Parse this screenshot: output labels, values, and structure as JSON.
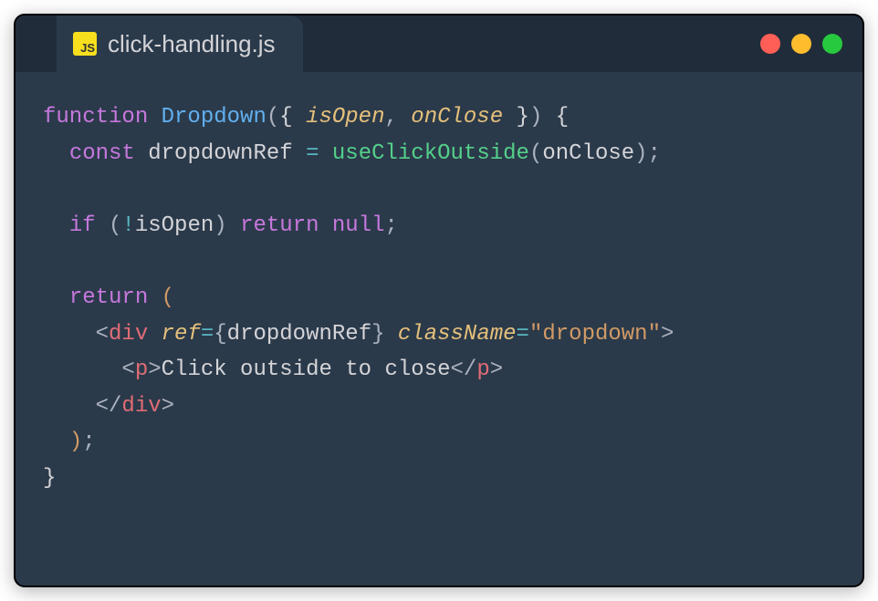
{
  "tab": {
    "filename": "click-handling.js",
    "icon_label": "JS"
  },
  "code": {
    "line1": {
      "kw_function": "function",
      "fn_name": "Dropdown",
      "param_isOpen": "isOpen",
      "comma": ",",
      "param_onClose": "onClose"
    },
    "line2": {
      "kw_const": "const",
      "var_dropdownRef": "dropdownRef",
      "op_eq": "=",
      "fn_useClickOutside": "useClickOutside",
      "arg_onClose": "onClose"
    },
    "line4": {
      "kw_if": "if",
      "op_not": "!",
      "var_isOpen": "isOpen",
      "kw_return": "return",
      "kw_null": "null"
    },
    "line6": {
      "kw_return": "return"
    },
    "line7": {
      "tag_div": "div",
      "attr_ref": "ref",
      "val_dropdownRef": "dropdownRef",
      "attr_className": "className",
      "str_dropdown": "\"dropdown\""
    },
    "line8": {
      "tag_p": "p",
      "text_content": "Click outside to close"
    },
    "line9": {
      "tag_div_close": "div"
    }
  }
}
